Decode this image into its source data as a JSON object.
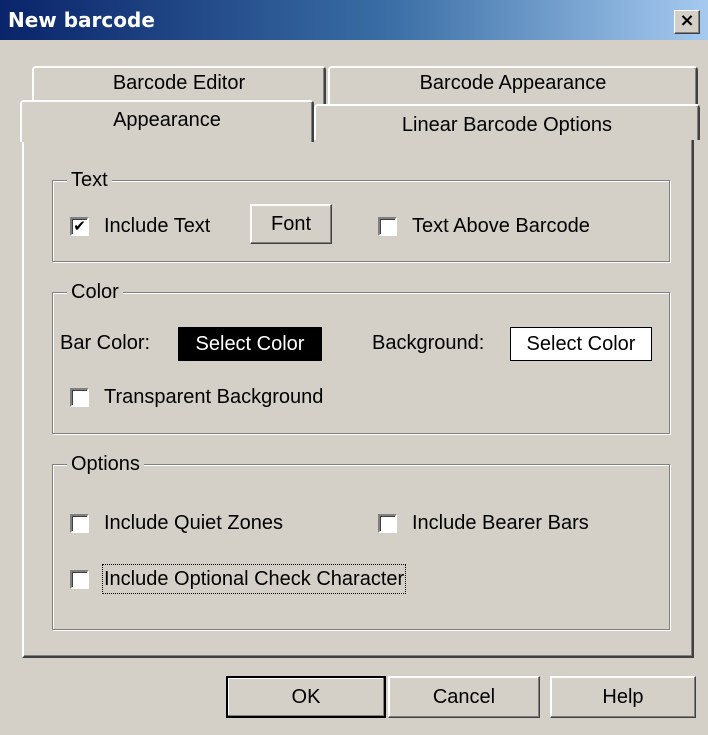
{
  "window": {
    "title": "New barcode",
    "close_symbol": "×"
  },
  "tabs": {
    "row_back": [
      "Barcode Editor",
      "Barcode Appearance"
    ],
    "row_front": [
      "Appearance",
      "Linear Barcode Options"
    ],
    "selected": "Appearance"
  },
  "text_group": {
    "label": "Text",
    "include_text": {
      "label": "Include Text",
      "checked": true,
      "mark": "✔"
    },
    "font_button": "Font",
    "text_above": {
      "label": "Text Above Barcode",
      "checked": false
    }
  },
  "color_group": {
    "label": "Color",
    "bar_color_label": "Bar Color:",
    "bar_color_button": "Select Color",
    "bar_color": "#000000",
    "background_label": "Background:",
    "background_button": "Select Color",
    "background_color": "#ffffff",
    "transparent": {
      "label": "Transparent Background",
      "checked": false
    }
  },
  "options_group": {
    "label": "Options",
    "quiet_zones": {
      "label": "Include Quiet Zones",
      "checked": false
    },
    "bearer_bars": {
      "label": "Include Bearer Bars",
      "checked": false
    },
    "check_char": {
      "label": "Include Optional Check Character",
      "checked": false
    }
  },
  "buttons": {
    "ok": "OK",
    "cancel": "Cancel",
    "help": "Help"
  }
}
